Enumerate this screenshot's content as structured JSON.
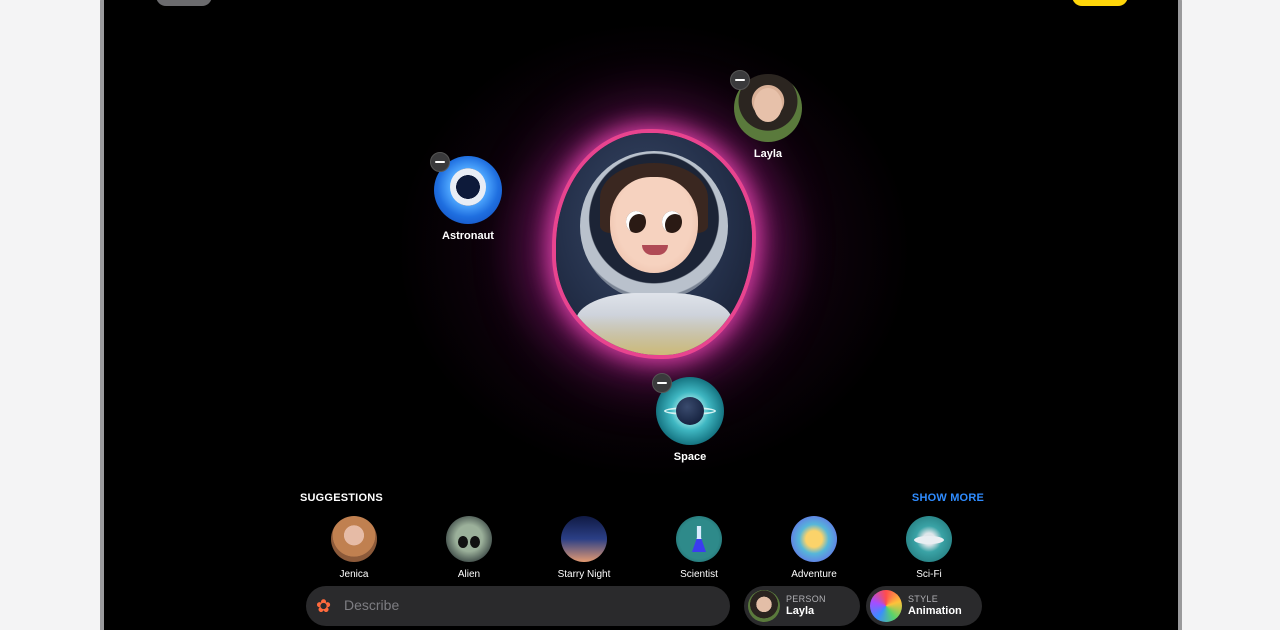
{
  "bubbles": {
    "astronaut": "Astronaut",
    "layla": "Layla",
    "space": "Space"
  },
  "suggestions": {
    "title": "SUGGESTIONS",
    "show_more": "SHOW MORE",
    "items": [
      {
        "label": "Jenica",
        "icon": "person-photo-icon"
      },
      {
        "label": "Alien",
        "icon": "alien-icon"
      },
      {
        "label": "Starry Night",
        "icon": "starry-night-icon"
      },
      {
        "label": "Scientist",
        "icon": "flask-icon"
      },
      {
        "label": "Adventure",
        "icon": "map-icon"
      },
      {
        "label": "Sci-Fi",
        "icon": "ufo-icon"
      }
    ]
  },
  "input": {
    "placeholder": "Describe",
    "value": ""
  },
  "person_pill": {
    "label": "PERSON",
    "value": "Layla"
  },
  "style_pill": {
    "label": "STYLE",
    "value": "Animation"
  },
  "colors": {
    "accent_link": "#2f8cff",
    "done_button": "#ffd60a",
    "glow": "#e8448f"
  }
}
